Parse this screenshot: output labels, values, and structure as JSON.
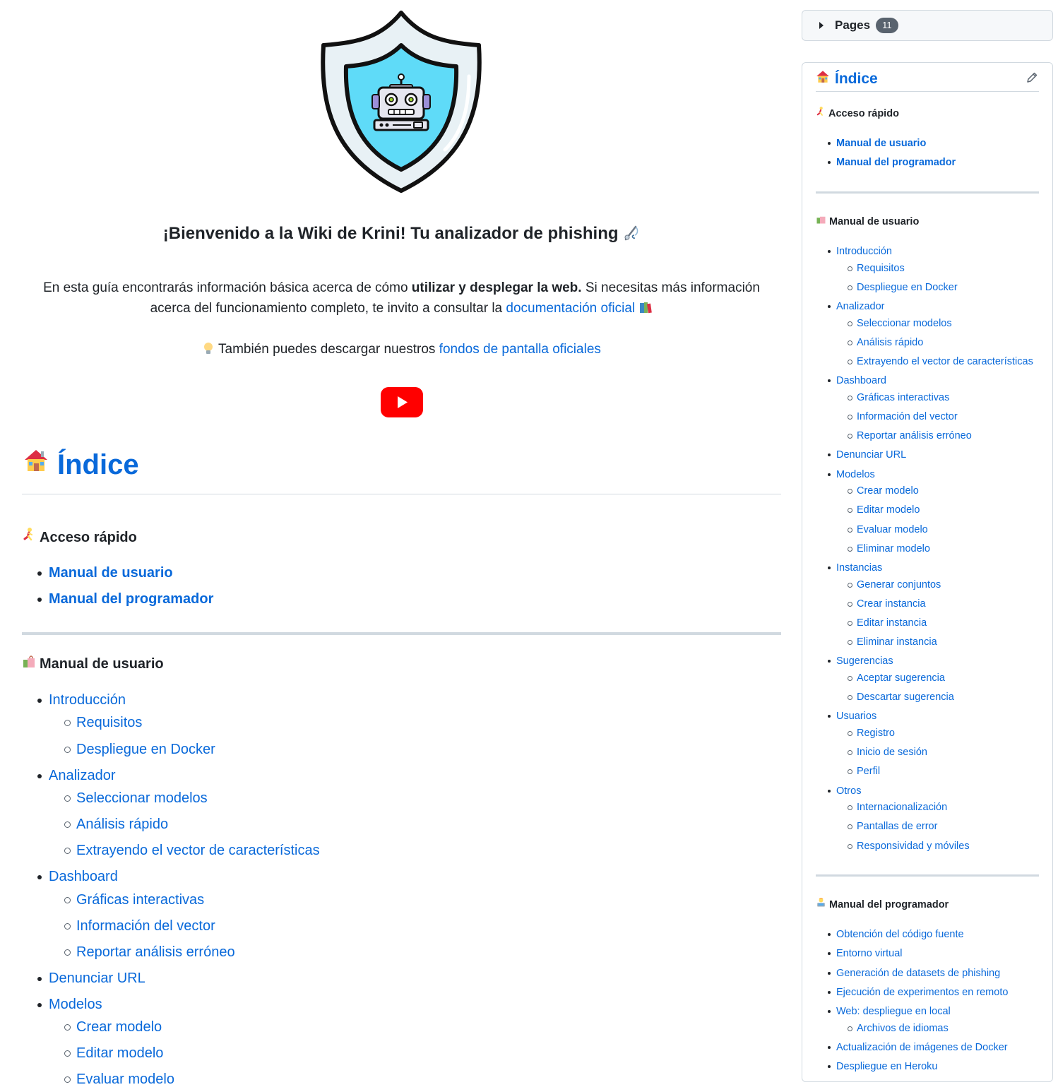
{
  "main": {
    "welcome": "¡Bienvenido a la Wiki de Krini! Tu analizador de phishing",
    "welcome_icon": "fishing-pole-icon",
    "intro_part1": "En esta guía encontrarás información básica acerca de cómo ",
    "intro_bold": "utilizar y desplegar la web.",
    "intro_part2": " Si necesitas más información acerca del funcionamiento completo, te invito a consultar la ",
    "intro_link": "documentación oficial",
    "intro_icon": "books-icon",
    "wallpapers_icon": "lightbulb-icon",
    "wallpapers_text": "También puedes descargar nuestros ",
    "wallpapers_link": "fondos de pantalla oficiales",
    "video_icon": "youtube-play-icon",
    "index_title": "Índice",
    "index_icon": "house-icon",
    "quick_access_title": "Acceso rápido",
    "quick_access_icon": "running-woman-icon",
    "quick_access": [
      "Manual de usuario",
      "Manual del programador"
    ],
    "user_manual_title": "Manual de usuario",
    "user_manual_icon": "shopping-bags-icon",
    "user_manual": [
      {
        "label": "Introducción",
        "children": [
          "Requisitos",
          "Despliegue en Docker"
        ]
      },
      {
        "label": "Analizador",
        "children": [
          "Seleccionar modelos",
          "Análisis rápido",
          "Extrayendo el vector de características"
        ]
      },
      {
        "label": "Dashboard",
        "children": [
          "Gráficas interactivas",
          "Información del vector",
          "Reportar análisis erróneo"
        ]
      },
      {
        "label": "Denunciar URL",
        "children": []
      },
      {
        "label": "Modelos",
        "children": [
          "Crear modelo",
          "Editar modelo",
          "Evaluar modelo"
        ]
      }
    ]
  },
  "sidebar": {
    "pages_label": "Pages",
    "pages_count": "11",
    "index_title": "Índice",
    "quick_access_title": "Acceso rápido",
    "quick_access": [
      "Manual de usuario",
      "Manual del programador"
    ],
    "user_manual_title": "Manual de usuario",
    "user_manual": [
      {
        "label": "Introducción",
        "children": [
          "Requisitos",
          "Despliegue en Docker"
        ]
      },
      {
        "label": "Analizador",
        "children": [
          "Seleccionar modelos",
          "Análisis rápido",
          "Extrayendo el vector de características"
        ]
      },
      {
        "label": "Dashboard",
        "children": [
          "Gráficas interactivas",
          "Información del vector",
          "Reportar análisis erróneo"
        ]
      },
      {
        "label": "Denunciar URL",
        "children": []
      },
      {
        "label": "Modelos",
        "children": [
          "Crear modelo",
          "Editar modelo",
          "Evaluar modelo",
          "Eliminar modelo"
        ]
      },
      {
        "label": "Instancias",
        "children": [
          "Generar conjuntos",
          "Crear instancia",
          "Editar instancia",
          "Eliminar instancia"
        ]
      },
      {
        "label": "Sugerencias",
        "children": [
          "Aceptar sugerencia",
          "Descartar sugerencia"
        ]
      },
      {
        "label": "Usuarios",
        "children": [
          "Registro",
          "Inicio de sesión",
          "Perfil"
        ]
      },
      {
        "label": "Otros",
        "children": [
          "Internacionalización",
          "Pantallas de error",
          "Responsividad y móviles"
        ]
      }
    ],
    "dev_manual_title": "Manual del programador",
    "dev_manual_icon": "technologist-icon",
    "dev_manual": [
      {
        "label": "Obtención del código fuente",
        "children": []
      },
      {
        "label": "Entorno virtual",
        "children": []
      },
      {
        "label": "Generación de datasets de phishing",
        "children": []
      },
      {
        "label": "Ejecución de experimentos en remoto",
        "children": []
      },
      {
        "label": "Web: despliegue en local",
        "children": [
          "Archivos de idiomas"
        ]
      },
      {
        "label": "Actualización de imágenes de Docker",
        "children": []
      },
      {
        "label": "Despliegue en Heroku",
        "children": []
      }
    ]
  },
  "colors": {
    "link": "#0969da",
    "text": "#1f2328",
    "border": "#d1d9e0",
    "badge": "#59636e",
    "youtube": "#ff0000",
    "shield_fill": "#5fdbf8"
  }
}
